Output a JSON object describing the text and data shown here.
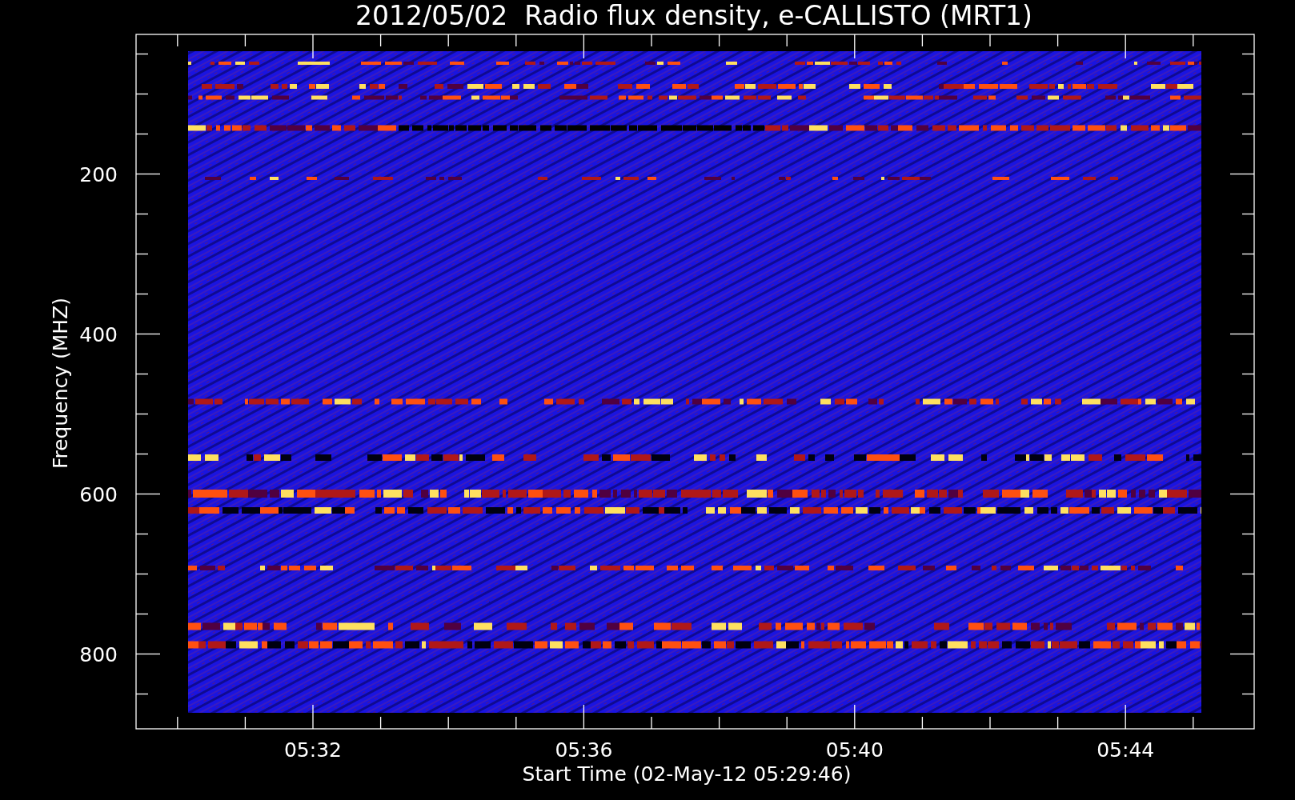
{
  "plot": {
    "title": "2012/05/02  Radio flux density, e-CALLISTO (MRT1)",
    "ylabel": "Frequency (MHZ)",
    "xlabel": "Start Time (02-May-12 05:29:46)",
    "y_tick_labels": [
      "200",
      "400",
      "600",
      "800"
    ],
    "x_tick_labels": [
      "05:32",
      "05:36",
      "05:40",
      "05:44"
    ]
  }
}
